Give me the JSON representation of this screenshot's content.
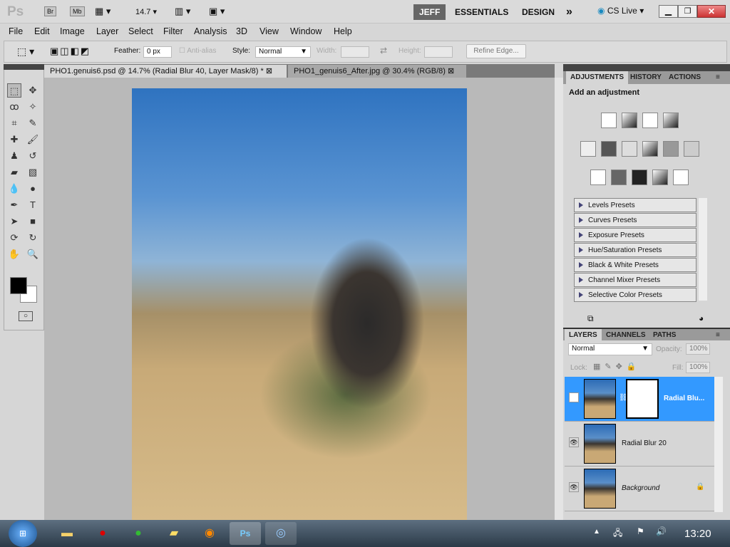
{
  "appbar": {
    "logo": "Ps",
    "bridge": "Br",
    "minibridge": "Mb",
    "zoom": "14.7",
    "workspaces": [
      "JEFF",
      "ESSENTIALS",
      "DESIGN"
    ],
    "more": "»",
    "cslive": "CS Live"
  },
  "menu": [
    "File",
    "Edit",
    "Image",
    "Layer",
    "Select",
    "Filter",
    "Analysis",
    "3D",
    "View",
    "Window",
    "Help"
  ],
  "options": {
    "feather_label": "Feather:",
    "feather_value": "0 px",
    "antialias": "Anti-alias",
    "style_label": "Style:",
    "style_value": "Normal",
    "width_label": "Width:",
    "height_label": "Height:",
    "refine": "Refine Edge..."
  },
  "tabs": [
    {
      "label": "PHO1.genuis6.psd @ 14.7% (Radial Blur 40, Layer Mask/8) *"
    },
    {
      "label": "PHO1_genuis6_After.jpg @ 30.4% (RGB/8)"
    }
  ],
  "adjustments": {
    "tabs": [
      "ADJUSTMENTS",
      "HISTORY",
      "ACTIONS"
    ],
    "heading": "Add an adjustment",
    "presets": [
      "Levels Presets",
      "Curves Presets",
      "Exposure Presets",
      "Hue/Saturation Presets",
      "Black & White Presets",
      "Channel Mixer Presets",
      "Selective Color Presets"
    ]
  },
  "layers": {
    "tabs": [
      "LAYERS",
      "CHANNELS",
      "PATHS"
    ],
    "blend": "Normal",
    "opacity_label": "Opacity:",
    "opacity": "100%",
    "lock_label": "Lock:",
    "fill_label": "Fill:",
    "fill": "100%",
    "items": [
      {
        "name": "Radial Blu...",
        "visible": false,
        "selected": true
      },
      {
        "name": "Radial Blur 20",
        "visible": true
      },
      {
        "name": "Background",
        "visible": true,
        "locked": true
      }
    ]
  },
  "taskbar": {
    "clock": "13:20"
  },
  "colors": {
    "accent": "#3399ff",
    "selected_layer": "#3399ff"
  }
}
